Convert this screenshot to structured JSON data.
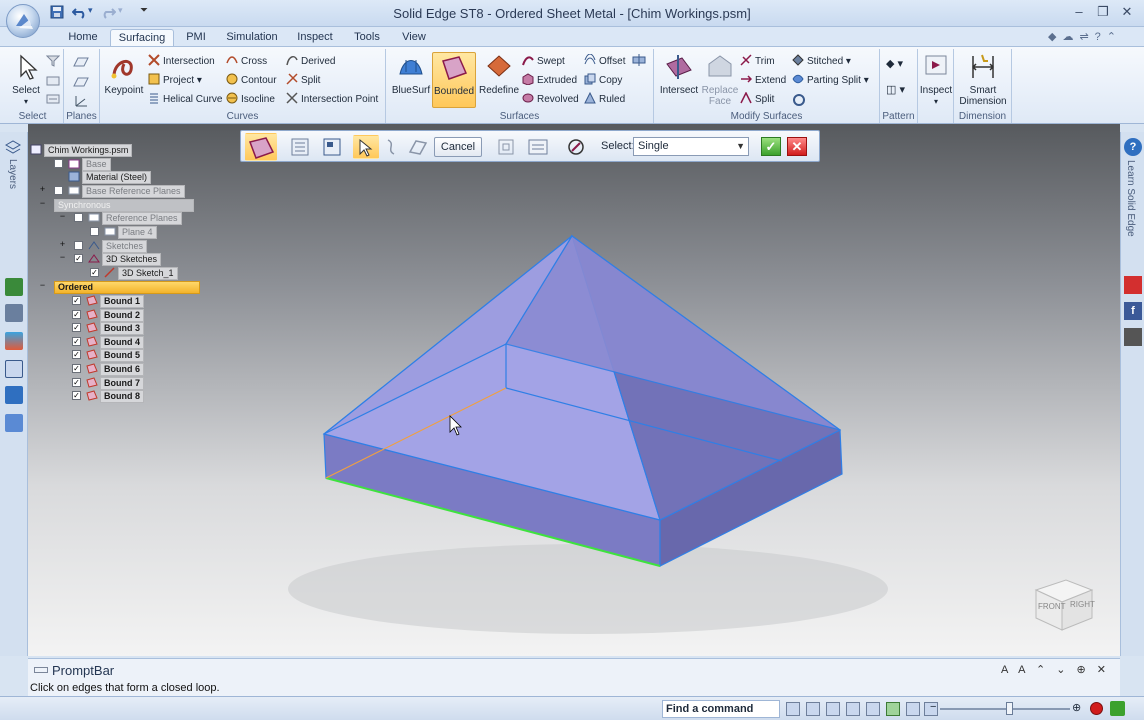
{
  "window": {
    "title": "Solid Edge ST8 - Ordered Sheet Metal - [Chim Workings.psm]"
  },
  "ribbon": {
    "tabs": [
      "Home",
      "Surfacing",
      "PMI",
      "Simulation",
      "Inspect",
      "Tools",
      "View"
    ],
    "active_tab": "Surfacing",
    "groups": {
      "select": {
        "label": "Select",
        "button": "Select"
      },
      "planes": {
        "label": "Planes"
      },
      "curves": {
        "label": "Curves",
        "keypoint": "Keypoint",
        "items": [
          "Intersection",
          "Project",
          "Helical Curve",
          "Cross",
          "Contour",
          "Isocline",
          "Derived",
          "Split",
          "Intersection Point"
        ]
      },
      "surfaces": {
        "label": "Surfaces",
        "bluesurf": "BlueSurf",
        "bounded": "Bounded",
        "redefine": "Redefine",
        "items": [
          "Swept",
          "Extruded",
          "Revolved",
          "Offset",
          "Copy",
          "Ruled"
        ]
      },
      "modify": {
        "label": "Modify Surfaces",
        "intersect": "Intersect",
        "replace_face": "Replace Face",
        "items": [
          "Trim",
          "Extend",
          "Split",
          "Stitched",
          "Parting Split"
        ]
      },
      "pattern": {
        "label": "Pattern"
      },
      "inspect": {
        "label": "",
        "button": "Inspect"
      },
      "dimension": {
        "label": "Dimension",
        "button": "Smart Dimension"
      }
    }
  },
  "command_bar": {
    "cancel": "Cancel",
    "select_label": "Select:",
    "select_value": "Single"
  },
  "pathfinder": {
    "root": "Chim Workings.psm",
    "base": "Base",
    "material": "Material (Steel)",
    "base_ref_planes": "Base Reference Planes",
    "synchronous": "Synchronous",
    "reference_planes": "Reference Planes",
    "plane4": "Plane 4",
    "sketches": "Sketches",
    "sketches3d": "3D Sketches",
    "sketch1": "3D Sketch_1",
    "ordered": "Ordered",
    "bounds": [
      "Bound 1",
      "Bound 2",
      "Bound 3",
      "Bound 4",
      "Bound 5",
      "Bound 6",
      "Bound 7",
      "Bound 8"
    ]
  },
  "right_rail": {
    "learn": "Learn Solid Edge"
  },
  "left_rail": {
    "layers": "Layers"
  },
  "viewcube": {
    "front": "FRONT",
    "right": "RIGHT"
  },
  "promptbar": {
    "title": "PromptBar",
    "message": "Click on edges that form a closed loop."
  },
  "statusbar": {
    "find_command": "Find a command"
  },
  "colors": {
    "model_fill": "#9a9ae0",
    "model_edge": "#2f7fe6",
    "selected_edge": "#3ee23e",
    "highlight_edge": "#f0a040",
    "ordered_node": "#f4b32a"
  }
}
